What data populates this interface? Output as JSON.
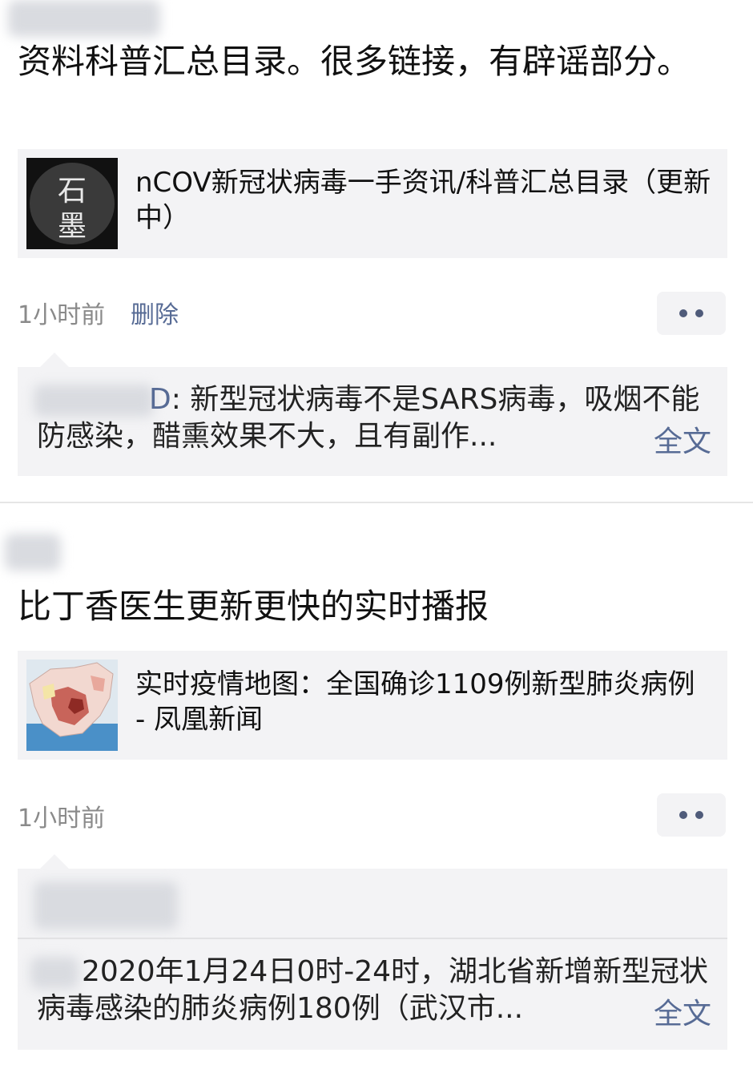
{
  "posts": [
    {
      "text": "资料科普汇总目录。很多链接，有辟谣部分。",
      "link": {
        "thumb_lines": [
          "石",
          "墨"
        ],
        "title": "nCOV新冠状病毒一手资讯/科普汇总目录（更新中）"
      },
      "time": "1小时前",
      "delete_label": "删除",
      "comment": {
        "author_suffix": "D",
        "text": ": 新型冠状病毒不是SARS病毒，吸烟不能防感染，醋熏效果不大，且有副作...",
        "full_label": "全文"
      }
    },
    {
      "text": "比丁香医生更新更快的实时播报",
      "link": {
        "title": "实时疫情地图：全国确诊1109例新型肺炎病例 - 凤凰新闻"
      },
      "time": "1小时前",
      "comment": {
        "text": "2020年1月24日0时-24时，湖北省新增新型冠状病毒感染的肺炎病例180例（武汉市...",
        "full_label": "全文"
      }
    }
  ],
  "icons": {
    "more": "more-dots-icon",
    "map": "china-map-thumbnail"
  },
  "colors": {
    "link": "#576b95",
    "card_bg": "#f3f3f5",
    "meta": "#8a8a8a"
  }
}
